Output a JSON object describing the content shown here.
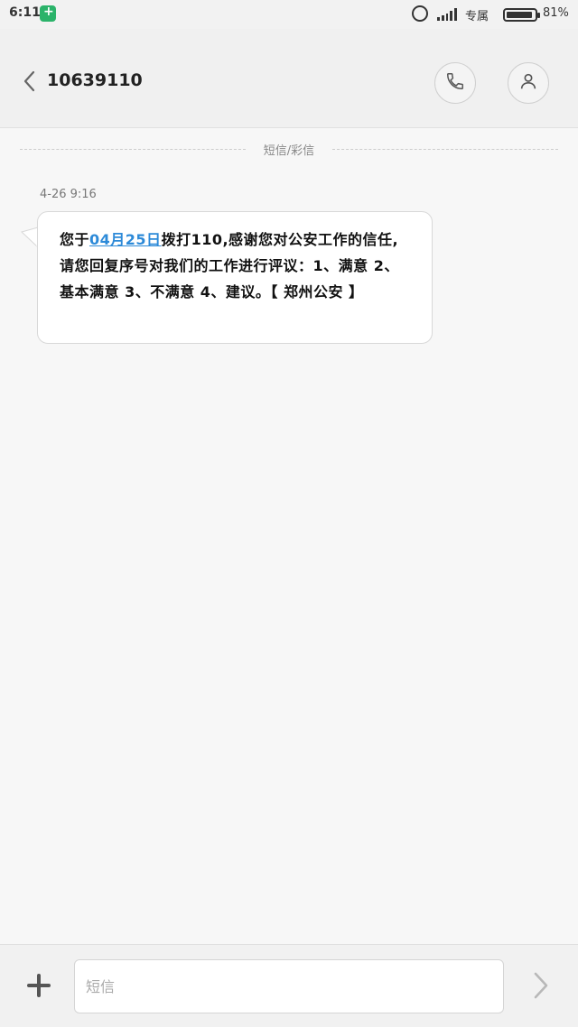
{
  "status_bar": {
    "time": "6:11",
    "carrier": "专属",
    "battery": "81%"
  },
  "header": {
    "contact": "10639110"
  },
  "channel_label": "短信/彩信",
  "message": {
    "timestamp": "4-26 9:16",
    "text_before": "您于",
    "date_link": "04月25日",
    "text_after": "拨打110,感谢您对公安工作的信任,请您回复序号对我们的工作进行评议：1、满意 2、基本满意 3、不满意 4、建议。【 郑州公安 】"
  },
  "compose": {
    "placeholder": "短信"
  },
  "colors": {
    "link": "#2d8ad8",
    "shield_badge": "#2bb36a"
  },
  "icons": [
    "shield-icon",
    "alarm-icon",
    "signal-icon",
    "battery-icon",
    "back-icon",
    "phone-icon",
    "person-icon",
    "add-icon",
    "send-icon"
  ]
}
